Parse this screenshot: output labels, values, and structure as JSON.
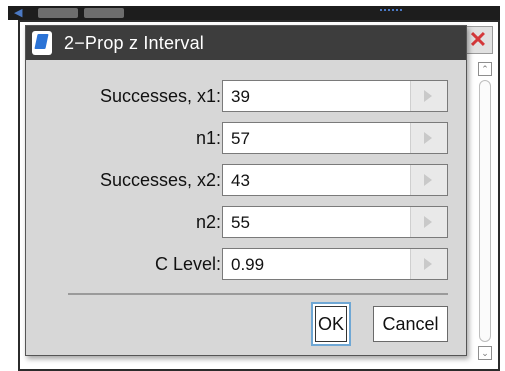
{
  "dialog": {
    "title": "2−Prop z Interval",
    "icon": "calculator-icon"
  },
  "fields": [
    {
      "label": "Successes, x1:",
      "value": "39"
    },
    {
      "label": "n1:",
      "value": "57"
    },
    {
      "label": "Successes, x2:",
      "value": "43"
    },
    {
      "label": "n2:",
      "value": "55"
    },
    {
      "label": "C Level:",
      "value": "0.99"
    }
  ],
  "buttons": {
    "ok": "OK",
    "cancel": "Cancel"
  },
  "colors": {
    "titlebar": "#3d3d3d",
    "dialog_bg": "#d7d7d7",
    "focus_ring": "#6fa7d4",
    "close": "#d4383a"
  }
}
